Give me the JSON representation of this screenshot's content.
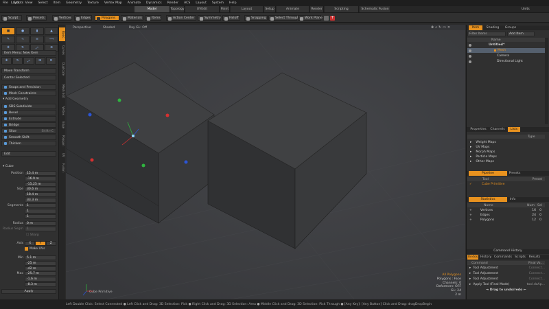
{
  "menu": [
    "File",
    "Edit",
    "View",
    "Select",
    "Item",
    "Geometry",
    "Texture",
    "Vertex Map",
    "Animate",
    "Dynamics",
    "Render",
    "ACS",
    "Layout",
    "System",
    "Help"
  ],
  "layout_label": "Layouts",
  "mode_tabs": [
    "Model",
    "Topology",
    "UVEdit",
    "Paint",
    "Layout",
    "Setup",
    "Animate",
    "Render",
    "Scripting",
    "Schematic Fusion"
  ],
  "active_mode_tab": "Model",
  "units_label": "Units",
  "toolbar": {
    "sculpt": "Sculpt",
    "presets": "Presets",
    "vertices": "Vertices",
    "edges": "Edges",
    "polygons": "Polygons",
    "materials": "Materials",
    "items": "Items",
    "action_center": "Action Center",
    "symmetry": "Symmetry",
    "falloff": "Falloff",
    "snapping": "Snapping",
    "select_through": "Select Through",
    "work_plane": "Work Plane"
  },
  "left_panel": {
    "menu_label": "Item Menu: New Item",
    "move_transform": "Move Transform",
    "center_selected": "Center Selected",
    "snaps": "Snaps and Precision",
    "mesh_constraints": "Mesh Constraints",
    "add_geometry": "Add Geometry",
    "tools": [
      "SDS Subdivide",
      "Bevel",
      "Extrude",
      "Bridge",
      "Slice",
      "Smooth Shift",
      "Thicken"
    ],
    "tool_shortcuts": [
      "",
      "",
      "",
      "",
      "Shift+C",
      "",
      ""
    ],
    "edit": "Edit",
    "cube_section": "Cube",
    "position_label": "Position",
    "position": [
      "15.4 m",
      "-16.9 m",
      "-15.25 m"
    ],
    "size_label": "Size",
    "size": [
      "30.6 m",
      "18.4 m",
      "33.3 m"
    ],
    "segments_label": "Segments",
    "segments": [
      "1",
      "1",
      "1"
    ],
    "radius_label": "Radius",
    "radius": "0 m",
    "radius_segs_label": "Radius Segm",
    "radius_segs": "1",
    "sharp": "Sharp",
    "axis_label": "Axis",
    "axis": [
      "X",
      "Y",
      "Z"
    ],
    "make_uvs": "Make UVs",
    "min_label": "Min",
    "min": [
      "5.1 m",
      "-25 m",
      "-42 m"
    ],
    "max_label": "Max",
    "max": [
      "-25.7 m",
      "-1.6 m",
      "-8.3 m"
    ],
    "apply": "Apply"
  },
  "vertical_tabs": [
    "Basic",
    "Curves",
    "Duplicate",
    "Mesh Edit",
    "Vertex",
    "Edge",
    "Polygon",
    "UV",
    "Fusion"
  ],
  "viewport": {
    "perspective": "Perspective",
    "shaded": "Shaded",
    "ray_gl": "Ray GL: Off",
    "item_label": "Cube Primitive",
    "info": [
      "All Polygons",
      "Polygons : Face",
      "Channels: 0",
      "Deformers: OFF",
      "GL: 24",
      "2 m"
    ]
  },
  "statusbar": "Left Double Click: Select Connected ● Left Click and Drag: 3D Selection: Pick ● Right Click and Drag: 3D Selection: Area ● Middle Click and Drag: 3D Selection: Pick Through ● [Any Key]: [Any Button] Click and Drag: dragDropBegin",
  "item_list": {
    "tabs": [
      "Item",
      "Shading",
      "Groups"
    ],
    "filter": "Filter Items",
    "add_item": "Add Item",
    "name_header": "Name",
    "items": [
      "Untitled*",
      "Mesh",
      "Camera",
      "Directional Light"
    ]
  },
  "properties": {
    "tabs": [
      "Properties",
      "Channels",
      "Lists"
    ],
    "col_type": "Type",
    "items": [
      "Weight Maps",
      "UV Maps",
      "Morph Maps",
      "Particle Maps",
      "Other Maps"
    ]
  },
  "pipeline": {
    "tabs": [
      "Pipeline",
      "Presets"
    ],
    "col_tool": "Tool",
    "col_preset": "Preset",
    "item": "Cube Primitive"
  },
  "statistics": {
    "tabs": [
      "Statistics",
      "Info"
    ],
    "col_name": "Name",
    "col_num": "Num",
    "col_sel": "Sel",
    "rows": [
      {
        "name": "Vertices",
        "num": "16",
        "sel": "0"
      },
      {
        "name": "Edges",
        "num": "24",
        "sel": "0"
      },
      {
        "name": "Polygons",
        "num": "12",
        "sel": "0"
      }
    ]
  },
  "command_history": {
    "title": "Command History",
    "tabs": [
      "Undos",
      "History",
      "Commands",
      "Scripts",
      "Results"
    ],
    "col_command": "Command",
    "col_final": "Final Va...",
    "rows": [
      "Tool Adjustment",
      "Tool Adjustment",
      "Tool Adjustment",
      "Apply Tool (Final Mode)"
    ],
    "row_values": [
      "Connect...",
      "Connect...",
      "Connect...",
      "tool.doAp..."
    ],
    "drag_hint": "→ Drag to undo/redo ←"
  },
  "colors": {
    "accent": "#e8921f",
    "viewport": "#3d3e41",
    "cube_face_top": "#3a3a3a",
    "panel": "#303030"
  }
}
